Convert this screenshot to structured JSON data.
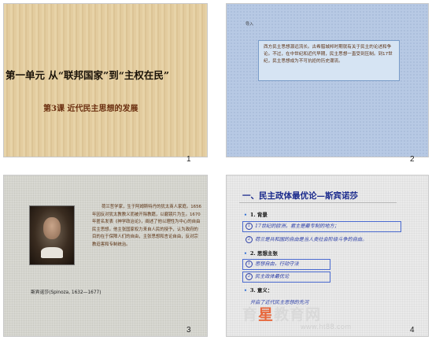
{
  "slides": [
    {
      "number": "1",
      "title": "第一单元 从“联邦国家”到“主权在民”",
      "subtitle": "第3课 近代民主思想的发展"
    },
    {
      "number": "2",
      "intro": "导入",
      "box_text": "西方民主思想源远流长。古希腊城邦时期就有关于民主的论述和争论。不过，在中世纪和近代早期，民主思想一直受到压制。到17世纪，民主思想成为不可抗拒的历史潮流。"
    },
    {
      "number": "3",
      "body": "荷兰哲学家，生于阿姆斯特丹的犹太商人家庭。1656年因反对犹太教教义而被开除教籍，以磨镜片为生。1670年匿名发表《神学政治论》，阐述了他以理性为中心的自由民主思想。他主张国家权力来自人民的授予，认为政府的目的在于保障人们的自由，主张思想和言论自由，反对宗教迫害和专制统治。",
      "caption": "斯宾诺莎(Spinoza, 1632—1677)"
    },
    {
      "number": "4",
      "heading": "一、民主政体最优论—斯宾诺莎",
      "items": [
        {
          "kind": "point",
          "text": "1. 背景"
        },
        {
          "kind": "circle",
          "mark": "1",
          "text": "17世纪的欧洲，君主是最专制的地方；"
        },
        {
          "kind": "circle",
          "mark": "2",
          "text": "荷兰是共和国的自由是当人类社会阶级斗争的自由。"
        },
        {
          "kind": "point",
          "text": "2. 思想主张"
        },
        {
          "kind": "circle",
          "mark": "1",
          "text": "思想自由，行动守法"
        },
        {
          "kind": "circle",
          "mark": "2",
          "text": "民主政体最优论"
        },
        {
          "kind": "point",
          "text": "3. 意义："
        },
        {
          "kind": "plain",
          "text": "开启了近代民主思想的先河"
        }
      ]
    }
  ],
  "watermark": {
    "brand_pre": "育",
    "brand_star": "星",
    "brand_post": "教育网",
    "url": "www.ht88.com"
  }
}
